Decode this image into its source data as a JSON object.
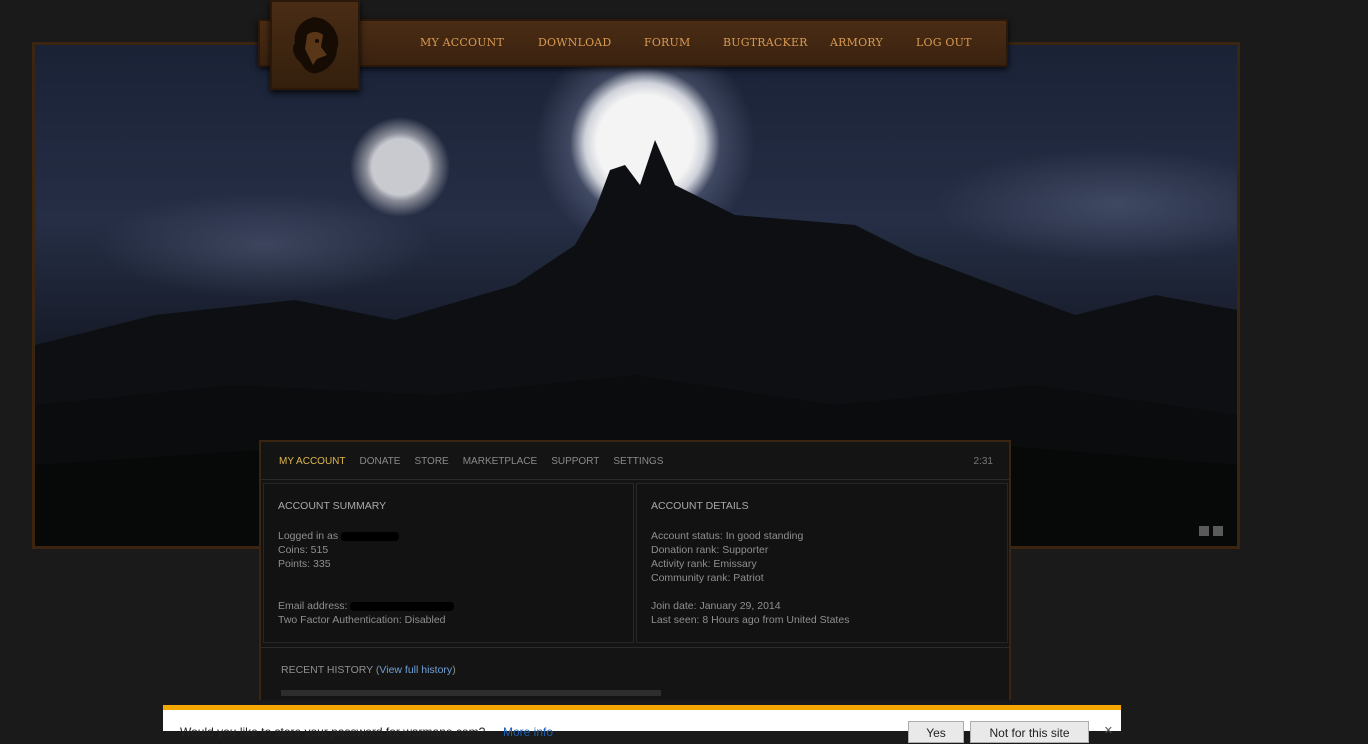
{
  "nav": {
    "items": [
      {
        "label": "MY ACCOUNT"
      },
      {
        "label": "DOWNLOAD"
      },
      {
        "label": "FORUM"
      },
      {
        "label": "BUGTRACKER"
      },
      {
        "label": "ARMORY"
      },
      {
        "label": "LOG OUT"
      }
    ],
    "logo_icon": "lion-head-icon"
  },
  "panel": {
    "tabs": [
      {
        "label": "MY ACCOUNT",
        "active": true
      },
      {
        "label": "DONATE"
      },
      {
        "label": "STORE"
      },
      {
        "label": "MARKETPLACE"
      },
      {
        "label": "SUPPORT"
      },
      {
        "label": "SETTINGS"
      }
    ],
    "time": "2:31",
    "summary": {
      "title": "ACCOUNT SUMMARY",
      "logged_in": "Logged in as",
      "coins": "Coins: 515",
      "points": "Points: 335",
      "email": "Email address:",
      "two_factor": "Two Factor Authentication: Disabled"
    },
    "details": {
      "title": "ACCOUNT DETAILS",
      "status": "Account status: In good standing",
      "donation_rank": "Donation rank: Supporter",
      "activity_rank": "Activity rank: Emissary",
      "community_rank": "Community rank: Patriot",
      "join_date": "Join date: January 29, 2014",
      "last_seen": "Last seen: 8 Hours ago from United States"
    },
    "history": {
      "title": "RECENT HISTORY (",
      "link": "View full history",
      "close": ")"
    }
  },
  "password_bar": {
    "message": "Would you like to store your password for warmane.com?",
    "more_info": "More info",
    "yes": "Yes",
    "not_for_site": "Not for this site",
    "close_icon": "close-icon",
    "accent": "#f5a800"
  }
}
